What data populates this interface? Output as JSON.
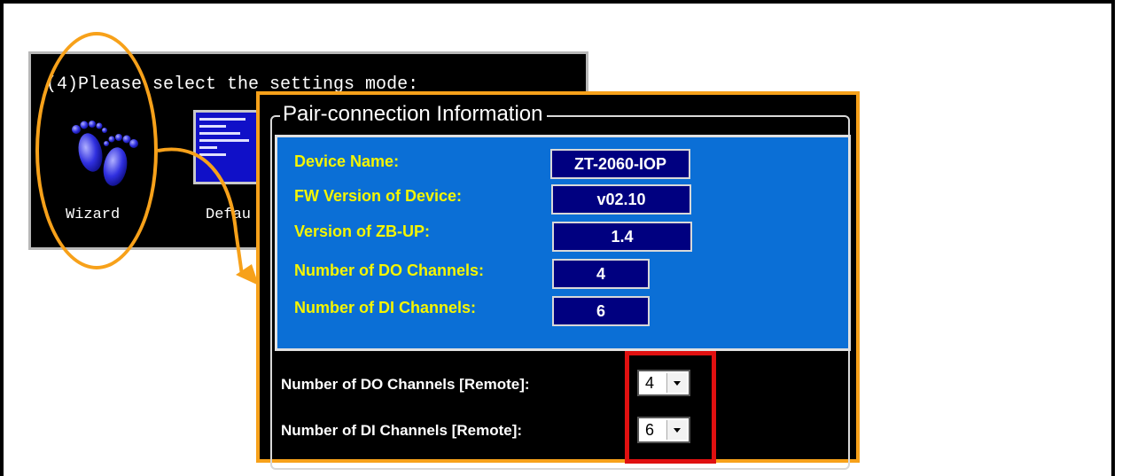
{
  "back_window": {
    "title": "(4)Please select the settings mode:",
    "wizard_label": "Wizard",
    "default_label": "Defau"
  },
  "front_window": {
    "group_title": "Pair-connection Information",
    "fields": [
      {
        "label": "Device Name:",
        "value": "ZT-2060-IOP"
      },
      {
        "label": "FW Version of Device:",
        "value": "v02.10"
      },
      {
        "label": "Version of ZB-UP:",
        "value": "1.4"
      },
      {
        "label": "Number of DO Channels:",
        "value": "4"
      },
      {
        "label": "Number of DI Channels:",
        "value": "6"
      }
    ],
    "remote": [
      {
        "label": "Number of DO Channels [Remote]:",
        "value": "4"
      },
      {
        "label": "Number of DI Channels [Remote]:",
        "value": "6"
      }
    ]
  },
  "colors": {
    "highlight_orange": "#f7a11a",
    "highlight_red": "#e01010",
    "panel_blue": "#0b6fd6",
    "label_yellow": "#f5f500"
  },
  "icons": [
    "footprints-icon",
    "default-settings-icon",
    "dropdown-arrow-icon"
  ]
}
